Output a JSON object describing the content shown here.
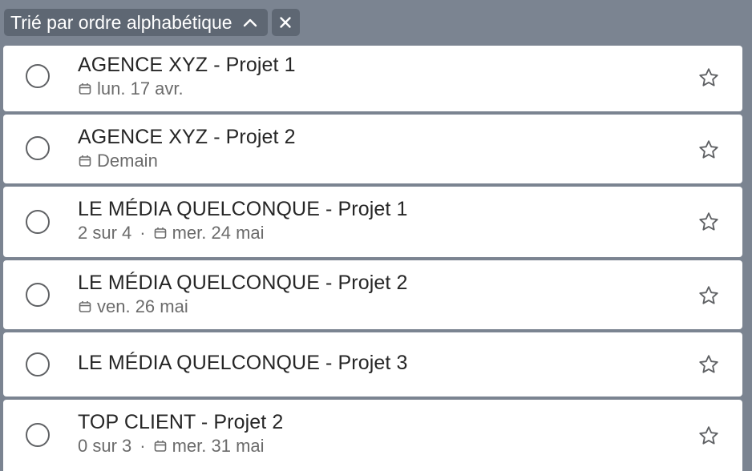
{
  "sort_bar": {
    "label": "Trié par ordre alphabétique",
    "toggle_icon": "chevron-up-icon",
    "clear_icon": "close-icon"
  },
  "tasks": [
    {
      "title": "AGENCE XYZ - Projet 1",
      "subtasks": "",
      "due": "lun. 17 avr."
    },
    {
      "title": "AGENCE XYZ - Projet 2",
      "subtasks": "",
      "due": "Demain"
    },
    {
      "title": "LE MÉDIA QUELCONQUE - Projet 1",
      "subtasks": "2 sur 4",
      "due": "mer. 24 mai"
    },
    {
      "title": "LE MÉDIA QUELCONQUE - Projet 2",
      "subtasks": "",
      "due": "ven. 26 mai"
    },
    {
      "title": "LE MÉDIA QUELCONQUE - Projet 3",
      "subtasks": "",
      "due": ""
    },
    {
      "title": "TOP CLIENT - Projet 2",
      "subtasks": "0 sur 3",
      "due": "mer. 31 mai"
    }
  ],
  "colors": {
    "background": "#7b8491",
    "chip": "#5e6773",
    "card": "#ffffff",
    "title_text": "#262626",
    "meta_text": "#6b6b6b"
  }
}
